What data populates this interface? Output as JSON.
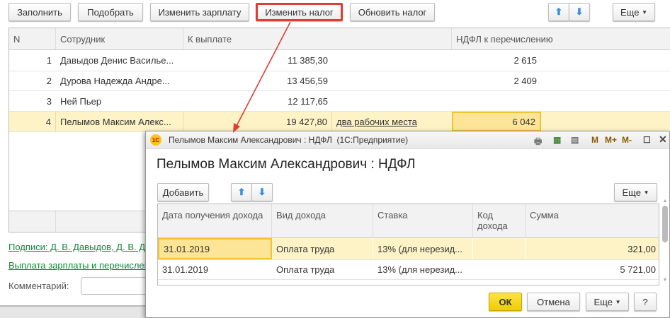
{
  "toolbar": {
    "fill": "Заполнить",
    "pick": "Подобрать",
    "change_salary": "Изменить зарплату",
    "change_tax": "Изменить налог",
    "update_tax": "Обновить налог",
    "more": "Еще",
    "up": "⬆",
    "down": "⬇"
  },
  "table": {
    "columns": [
      "N",
      "Сотрудник",
      "К выплате",
      "",
      "НДФЛ к перечислению"
    ],
    "rows": [
      {
        "n": "1",
        "employee": "Давыдов Денис Василье...",
        "pay": "11 385,30",
        "note": "",
        "ndfl": "2 615"
      },
      {
        "n": "2",
        "employee": "Дурова Надежда Андре...",
        "pay": "13 456,59",
        "note": "",
        "ndfl": "2 409"
      },
      {
        "n": "3",
        "employee": "Ней Пьер",
        "pay": "12 117,65",
        "note": "",
        "ndfl": ""
      },
      {
        "n": "4",
        "employee": "Пелымов Максим Алекс...",
        "pay": "19 427,80",
        "note": "два рабочих места",
        "ndfl": "6 042"
      }
    ]
  },
  "footer": {
    "signatures": "Подписи: Д. В. Давыдов, Д. В. Д",
    "payment": "Выплата зарплаты и перечислен",
    "comment_label": "Комментарий:",
    "comment_value": ""
  },
  "dialog": {
    "window_title": "Пелымов Максим Александрович : НДФЛ  (1С:Предприятие)",
    "logo": "1С",
    "heading": "Пелымов Максим Александрович : НДФЛ",
    "add": "Добавить",
    "more": "Еще",
    "mem": [
      "M",
      "M+",
      "M-"
    ],
    "columns": [
      "Дата получения дохода",
      "Вид дохода",
      "Ставка",
      "Код дохода",
      "Сумма"
    ],
    "rows": [
      {
        "date": "31.01.2019",
        "type": "Оплата труда",
        "rate": "13% (для нерезид...",
        "code": "",
        "sum": "321,00"
      },
      {
        "date": "31.01.2019",
        "type": "Оплата труда",
        "rate": "13% (для нерезид...",
        "code": "",
        "sum": "5 721,00"
      }
    ],
    "ok": "ОК",
    "cancel": "Отмена",
    "help": "?"
  },
  "colors": {
    "highlight": "#e03c31",
    "selected_row": "#fdf3c6",
    "link": "#0a8a3c",
    "ok_button": "#f5d60a"
  }
}
